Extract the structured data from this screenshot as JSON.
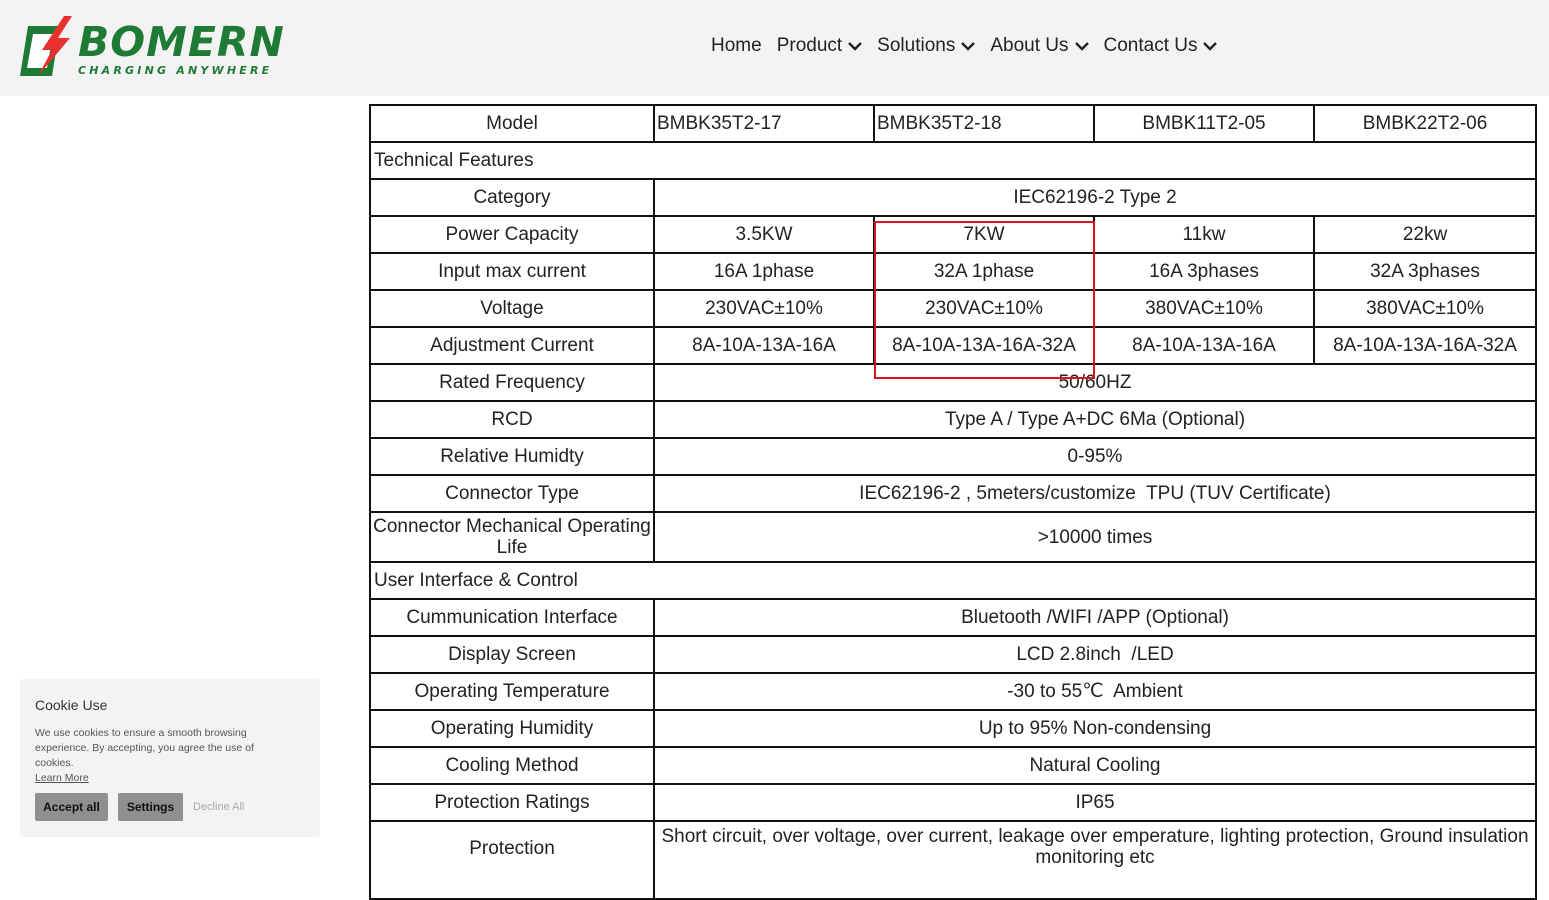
{
  "brand": {
    "name": "BOMERN",
    "tagline": "CHARGING ANYWHERE",
    "color": "#1f7a36",
    "accent": "#e8312f"
  },
  "nav": {
    "items": [
      "Home",
      "Product",
      "Solutions",
      "About Us",
      "Contact Us"
    ]
  },
  "table": {
    "models": {
      "label": "Model",
      "values": [
        "BMBK35T2-17",
        "BMBK35T2-18",
        "BMBK11T2-05",
        "BMBK22T2-06"
      ]
    },
    "sections": {
      "technical": "Technical Features",
      "ui": "User Interface & Control"
    },
    "rows": {
      "category": {
        "label": "Category",
        "value": "IEC62196-2 Type 2"
      },
      "power": {
        "label": "Power Capacity",
        "values": [
          "3.5KW",
          "7KW",
          "11kw",
          "22kw"
        ]
      },
      "input": {
        "label": "Input max current",
        "values": [
          "16A 1phase",
          "32A 1phase",
          "16A 3phases",
          "32A 3phases"
        ]
      },
      "voltage": {
        "label": "Voltage",
        "values": [
          "230VAC±10%",
          "230VAC±10%",
          "380VAC±10%",
          "380VAC±10%"
        ]
      },
      "adjust": {
        "label": "Adjustment Current",
        "values": [
          "8A-10A-13A-16A",
          "8A-10A-13A-16A-32A",
          "8A-10A-13A-16A",
          "8A-10A-13A-16A-32A"
        ]
      },
      "freq": {
        "label": "Rated Frequency",
        "value": "50/60HZ"
      },
      "rcd": {
        "label": "RCD",
        "value": "Type A / Type A+DC 6Ma (Optional)"
      },
      "humidity": {
        "label": "Relative Humidty",
        "value": "0-95%"
      },
      "connector": {
        "label": "Connector Type",
        "value": "IEC62196-2 , 5meters/customize  TPU (TUV Certificate)"
      },
      "mech_life": {
        "label": "Connector Mechanical Operating Life",
        "value": ">10000 times"
      },
      "comm": {
        "label": "Cummunication Interface",
        "value": "Bluetooth /WIFI /APP (Optional)"
      },
      "display": {
        "label": "Display Screen",
        "value": "LCD 2.8inch  /LED"
      },
      "op_temp": {
        "label": "Operating Temperature",
        "value": "-30 to 55℃  Ambient"
      },
      "op_hum": {
        "label": "Operating Humidity",
        "value": "Up to 95% Non-condensing"
      },
      "cooling": {
        "label": "Cooling Method",
        "value": "Natural Cooling"
      },
      "ip": {
        "label": "Protection Ratings",
        "value": "IP65"
      },
      "protection": {
        "label": "Protection",
        "value": "Short circuit, over voltage, over current, leakage over emperature, lighting protection, Ground insulation monitoring etc"
      }
    },
    "highlight_color": "#d0191f"
  },
  "cookie": {
    "title": "Cookie Use",
    "text": "We use cookies to ensure a smooth browsing experience. By accepting, you agree the use of cookies.",
    "learn_more": "Learn More",
    "accept": "Accept all",
    "settings": "Settings",
    "decline": "Decline All"
  }
}
